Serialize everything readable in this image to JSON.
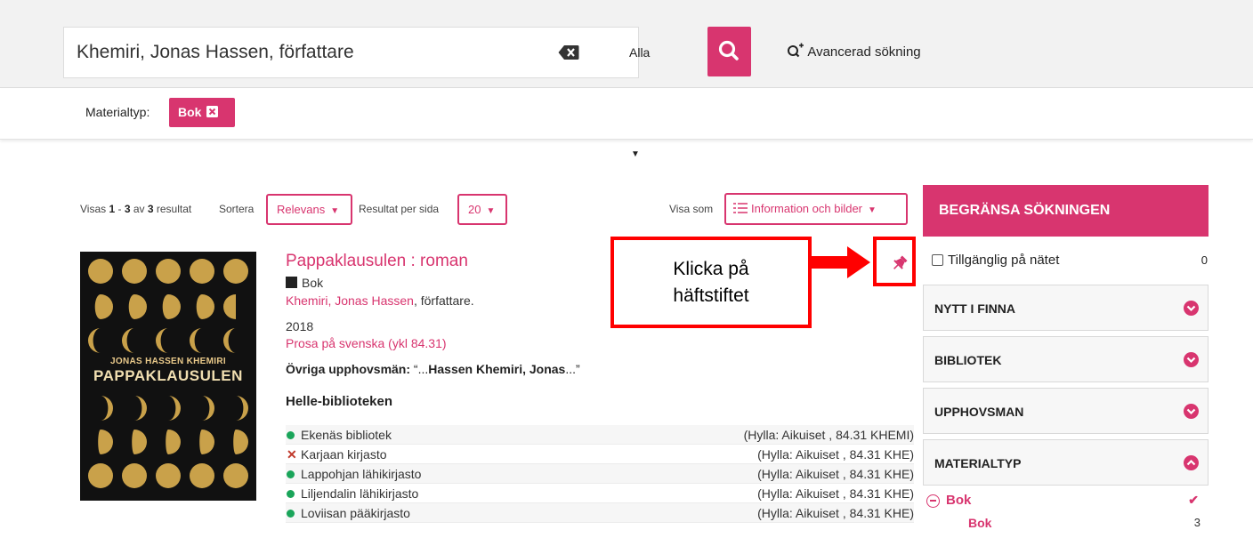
{
  "search": {
    "query": "Khemiri, Jonas Hassen, författare",
    "field_select": "Alla fält",
    "advanced_link": "Avancerad sökning"
  },
  "filters": {
    "label": "Materialtyp:",
    "chip": "Bok"
  },
  "results_bar": {
    "showing_prefix": "Visas ",
    "range_start": "1",
    "range_sep": " - ",
    "range_end": "3",
    "of_word": " av ",
    "total": "3",
    "suffix": " resultat",
    "sort_label": "Sortera",
    "sort_value": "Relevans",
    "per_page_label": "Resultat per sida",
    "per_page_value": "20",
    "view_label": "Visa som",
    "view_value": "Information och bilder"
  },
  "record": {
    "cover_author": "JONAS HASSEN KHEMIRI",
    "cover_title": "PAPPAKLAUSULEN",
    "title": "Pappaklausulen : roman",
    "format": "Bok",
    "author_name": "Khemiri, Jonas Hassen",
    "author_role": ", författare.",
    "year": "2018",
    "classification": "Prosa på svenska (ykl 84.31)",
    "other_creators_label": "Övriga upphovsmän:",
    "other_creators_pre": " “...",
    "other_creators_match": "Hassen Khemiri, Jonas",
    "other_creators_post": "...”",
    "organisation": "Helle-biblioteken",
    "holdings": [
      {
        "library": "Ekenäs bibliotek",
        "status": "available",
        "shelf": "(Hylla: Aikuiset , 84.31 KHEMI)"
      },
      {
        "library": "Karjaan kirjasto",
        "status": "unavailable",
        "shelf": "(Hylla: Aikuiset , 84.31 KHE)"
      },
      {
        "library": "Lappohjan lähikirjasto",
        "status": "available",
        "shelf": "(Hylla: Aikuiset , 84.31 KHE)"
      },
      {
        "library": "Liljendalin lähikirjasto",
        "status": "available",
        "shelf": "(Hylla: Aikuiset , 84.31 KHE)"
      },
      {
        "library": "Loviisan pääkirjasto",
        "status": "available",
        "shelf": "(Hylla: Aikuiset , 84.31 KHE)"
      }
    ]
  },
  "annotation": {
    "line1": "Klicka på",
    "line2": "häftstiftet"
  },
  "sidebar": {
    "header": "BEGRÄNSA SÖKNINGEN",
    "online_label": "Tillgänglig på nätet",
    "online_count": "0",
    "facets": [
      "NYTT I FINNA",
      "BIBLIOTEK",
      "UPPHOVSMAN",
      "MATERIALTYP"
    ],
    "selected_facet": "Bok",
    "selected_child": "Bok",
    "selected_child_count": "3"
  },
  "colors": {
    "accent": "#d8356f",
    "annotation": "#ff0000",
    "available": "#1aa55a",
    "unavailable": "#c0392b"
  }
}
